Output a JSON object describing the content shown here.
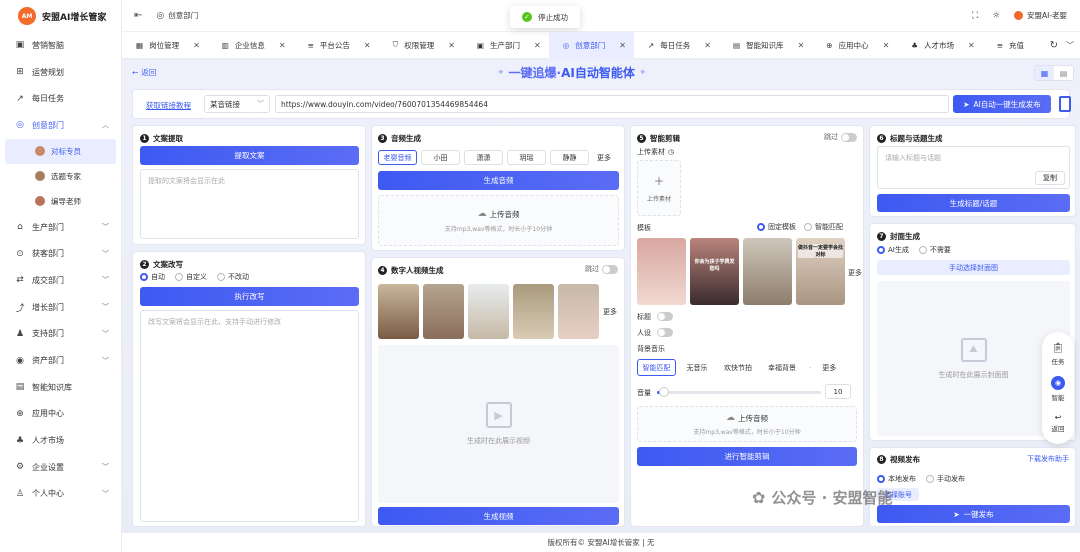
{
  "app": {
    "title": "安盟AI增长管家",
    "logo_badge": "AM"
  },
  "sidebar": {
    "items": [
      {
        "label": "营销智脑",
        "icon": "briefcase-icon"
      },
      {
        "label": "运营规划",
        "icon": "grid-icon"
      },
      {
        "label": "每日任务",
        "icon": "trend-icon"
      },
      {
        "label": "创意部门",
        "icon": "globe-icon"
      },
      {
        "label": "生产部门",
        "icon": "factory-icon"
      },
      {
        "label": "获客部门",
        "icon": "magnet-icon"
      },
      {
        "label": "成交部门",
        "icon": "handshake-icon"
      },
      {
        "label": "增长部门",
        "icon": "growth-icon"
      },
      {
        "label": "支持部门",
        "icon": "support-icon"
      },
      {
        "label": "资产部门",
        "icon": "asset-icon"
      },
      {
        "label": "智能知识库",
        "icon": "book-icon"
      },
      {
        "label": "应用中心",
        "icon": "app-icon"
      },
      {
        "label": "人才市场",
        "icon": "people-icon"
      },
      {
        "label": "企业设置",
        "icon": "settings-icon"
      },
      {
        "label": "个人中心",
        "icon": "user-icon"
      }
    ],
    "sub_items": [
      {
        "label": "对标专员"
      },
      {
        "label": "选题专家"
      },
      {
        "label": "编导老师"
      }
    ]
  },
  "topbar": {
    "breadcrumb": "创意部门",
    "toast": "停止成功",
    "user": "安盟AI-老婴"
  },
  "tabs": [
    {
      "label": "岗位管理"
    },
    {
      "label": "企业信息"
    },
    {
      "label": "平台公告"
    },
    {
      "label": "权限管理"
    },
    {
      "label": "生产部门"
    },
    {
      "label": "创意部门"
    },
    {
      "label": "每日任务"
    },
    {
      "label": "智能知识库"
    },
    {
      "label": "应用中心"
    },
    {
      "label": "人才市场"
    },
    {
      "label": "充值"
    }
  ],
  "page": {
    "back": "返回",
    "title_part1": "一键追爆·",
    "title_part2": "AI自动智能体"
  },
  "urlbar": {
    "link_label": "获取链接教程",
    "select_value": "某音链接",
    "url_value": "https://www.douyin.com/video/7600701354469854464",
    "publish_btn": "AI自动一键生成发布"
  },
  "card1": {
    "num": "1",
    "title": "文案提取",
    "btn": "提取文案",
    "placeholder": "提取的文案将会显示在此"
  },
  "card2": {
    "num": "2",
    "title": "文案改写",
    "opt1": "自动",
    "opt2": "自定义",
    "opt3": "不改动",
    "btn": "执行改写",
    "placeholder": "改写文案将会显示在此，支持手动进行修改"
  },
  "card3": {
    "num": "3",
    "title": "音频生成",
    "voices": [
      "老婴音频",
      "小田",
      "潇潇",
      "玥瑶",
      "静静"
    ],
    "more": "更多",
    "btn": "生成音频",
    "upload": "上传音频",
    "upload_hint": "支持mp3,wav等格式，时长小于10分钟"
  },
  "card4": {
    "num": "4",
    "title": "数字人视频生成",
    "skip": "跳过",
    "more": "更多",
    "placeholder": "生成时在此展示视频",
    "btn": "生成视频"
  },
  "card5": {
    "num": "5",
    "title": "智能剪辑",
    "skip": "跳过",
    "upload_label": "上传素材",
    "upload_btn": "上传素材",
    "template_label": "模板",
    "opt_fixed": "固定模板",
    "opt_smart": "智能匹配",
    "more": "更多",
    "label_title": "标题",
    "label_persona": "人设",
    "label_bgm": "背景音乐",
    "bgm": [
      "智能匹配",
      "无音乐",
      "欢快节拍",
      "幸福背景"
    ],
    "bgm_more": "更多",
    "volume_label": "音量",
    "volume_value": "10",
    "volume_fraction": 0.04,
    "upload_audio": "上传音频",
    "upload_audio_hint": "支持mp3,wav等格式，时长小于10分钟",
    "btn": "进行智能剪辑",
    "thumb_captions": [
      "",
      "你会为孩子学费发愁吗",
      "",
      "做抖音一定要学会找对标"
    ]
  },
  "card6": {
    "num": "6",
    "title": "标题与话题生成",
    "placeholder": "请输入标题与话题",
    "copy": "复制",
    "btn": "生成标题/话题"
  },
  "card7": {
    "num": "7",
    "title": "封面生成",
    "opt1": "AI生成",
    "opt2": "不需要",
    "manual": "手动选择封面图",
    "placeholder": "生成时在此展示封面图"
  },
  "card8": {
    "num": "8",
    "title": "视频发布",
    "download": "下载发布助手",
    "opt1": "本地发布",
    "opt2": "手动发布",
    "account": "选择账号",
    "btn": "一键发布"
  },
  "float": {
    "task": "任务",
    "ai": "智能",
    "back": "返回"
  },
  "watermark": "公众号 · 安盟智能",
  "footer": "版权所有© 安盟AI增长管家 | 无",
  "colors": {
    "accent": "#3d5af1",
    "brand": "#f26b2a"
  }
}
